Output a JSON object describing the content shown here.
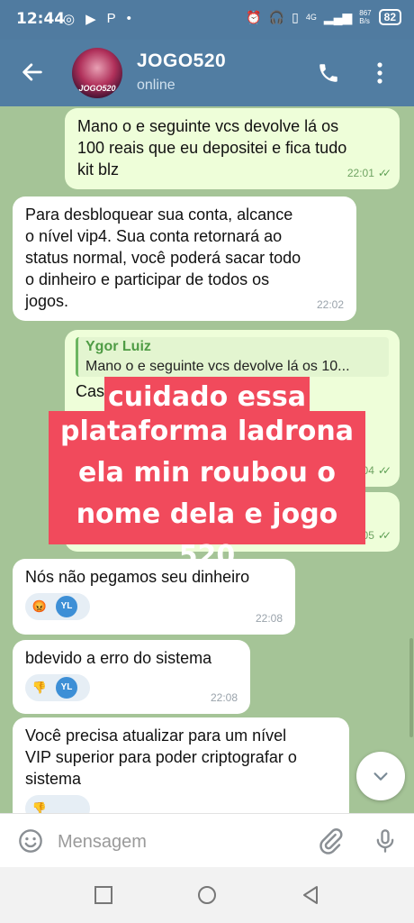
{
  "status_bar": {
    "time": "12:44",
    "left_icons": [
      "◎",
      "▶",
      "P",
      "•"
    ],
    "network_label": "4G",
    "speed_label": "867\nB/s",
    "battery": "82"
  },
  "header": {
    "title": "JOGO520",
    "subtitle": "online",
    "avatar_text": "JOGO520"
  },
  "messages": [
    {
      "id": "m1",
      "direction": "out",
      "text": "Mano o e seguinte vcs devolve lá os\n100 reais que eu depositei e fica tudo\nkit blz",
      "time": "22:01"
    },
    {
      "id": "m2",
      "direction": "in",
      "text": "Para desbloquear sua conta, alcance\no nível vip4. Sua conta retornará ao\nstatus normal, você poderá sacar todo\no dinheiro e participar de todos os\njogos.",
      "time": "22:02"
    },
    {
      "id": "m3",
      "direction": "out",
      "reply_name": "Ygor Luiz",
      "reply_snippet": "Mano o e seguinte vcs devolve lá os 10...",
      "text": "Cas                                        eu entra",
      "time": "22:04"
    },
    {
      "id": "m4",
      "direction": "out",
      "text": "",
      "time": "22:05"
    },
    {
      "id": "m5",
      "direction": "in",
      "text": "Nós não pegamos seu dinheiro",
      "time": "22:08",
      "reaction": "😡",
      "reaction_user": "YL"
    },
    {
      "id": "m6",
      "direction": "in",
      "text": "bdevido a erro do sistema",
      "time": "22:08",
      "reaction": "👎",
      "reaction_user": "YL"
    },
    {
      "id": "m7",
      "direction": "in",
      "text": "Você precisa atualizar para um nível\nVIP superior para poder criptografar o\nsistema",
      "reaction": "👎"
    }
  ],
  "overlay": {
    "line1": "cuidado essa",
    "line2": "plataforma ladrona\nela min roubou o\nnome dela e  jogo 520"
  },
  "composer": {
    "placeholder": "Mensagem"
  },
  "colors": {
    "header": "#517da2",
    "chat_bg": "#a5c497",
    "outgoing": "#eefed9",
    "overlay": "#f14a5c"
  }
}
